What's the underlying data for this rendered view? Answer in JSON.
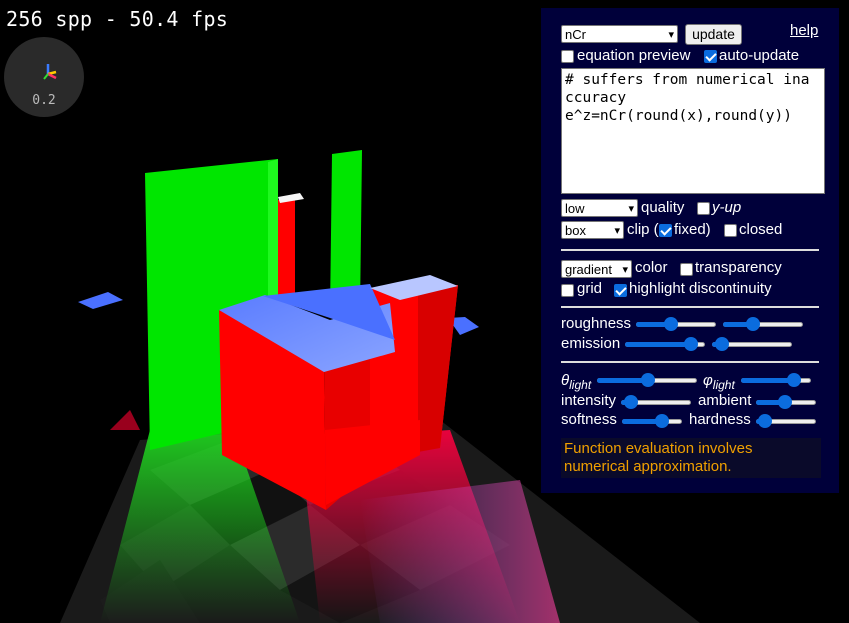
{
  "hud": {
    "fps_text": "256 spp - 50.4 fps",
    "axis_scale": "0.2"
  },
  "panel": {
    "function_select": "nCr",
    "update_label": "update",
    "help_label": "help",
    "equation_preview_label": "equation preview",
    "equation_preview_checked": false,
    "auto_update_label": "auto-update",
    "auto_update_checked": true,
    "code_lines": [
      "# suffers from numerical ina",
      "ccuracy",
      "e^z=nCr(round(x),round(y))"
    ],
    "quality_select": "low",
    "quality_label": "quality",
    "y_up_label": "y-up",
    "y_up_checked": false,
    "clip_select": "box",
    "clip_label": "clip (",
    "fixed_label": "fixed)",
    "fixed_checked": true,
    "closed_label": "closed",
    "closed_checked": false,
    "color_select": "gradient",
    "color_label": "color",
    "transparency_label": "transparency",
    "transparency_checked": false,
    "grid_label": "grid",
    "grid_checked": false,
    "highlight_label": "highlight discontinuity",
    "highlight_checked": true,
    "roughness_label": "roughness",
    "roughness_values": [
      0.42,
      0.35
    ],
    "emission_label": "emission",
    "emission_values": [
      0.9,
      0.05
    ],
    "theta_label": "θ",
    "theta_sub": "light",
    "theta_value": 0.51,
    "phi_label": "φ",
    "phi_sub": "light",
    "phi_value": 0.82,
    "intensity_label": "intensity",
    "intensity_value": 0.05,
    "ambient_label": "ambient",
    "ambient_value": 0.48,
    "softness_label": "softness",
    "softness_value": 0.72,
    "hardness_label": "hardness",
    "hardness_value": 0.05,
    "warning_text": "Function evaluation involves numerical approximation."
  },
  "colors": {
    "panel_bg": "#00003a",
    "accent": "#0b6cde",
    "warning": "#f0a000"
  }
}
